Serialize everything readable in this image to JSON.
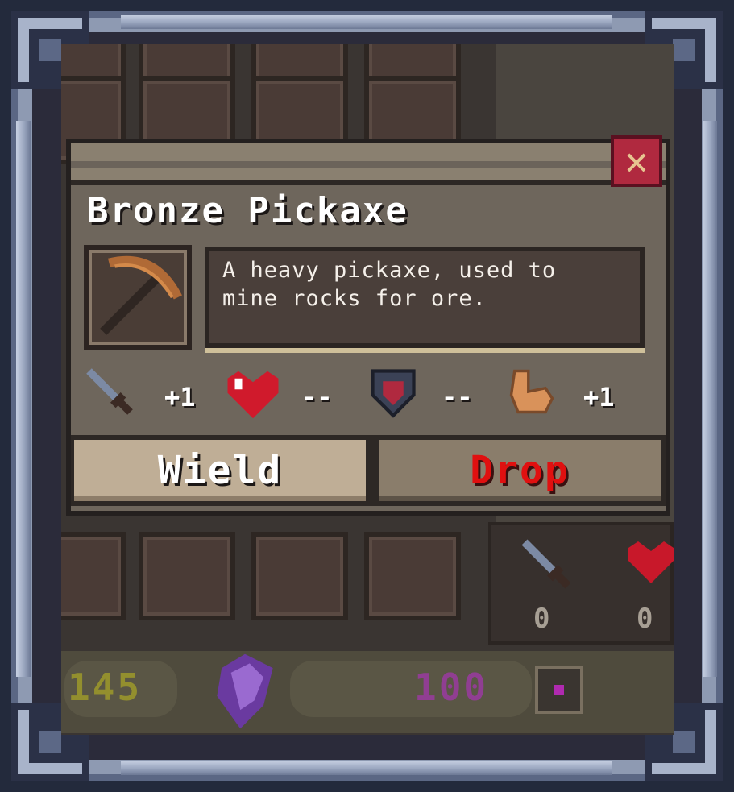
{
  "item": {
    "name": "Bronze Pickaxe",
    "description_line1": "A heavy pickaxe, used to",
    "description_line2": "mine rocks for ore.",
    "icon": "bronze-pickaxe-icon"
  },
  "stats": [
    {
      "icon": "sword-icon",
      "label": "attack",
      "value": "+1"
    },
    {
      "icon": "heart-icon",
      "label": "health",
      "value": "--"
    },
    {
      "icon": "shield-icon",
      "label": "defense",
      "value": "--"
    },
    {
      "icon": "flexed-arm-icon",
      "label": "strength",
      "value": "+1"
    }
  ],
  "actions": {
    "wield_label": "Wield",
    "drop_label": "Drop"
  },
  "background": {
    "gold_count": "145",
    "gem_count": "100",
    "stat_attack": "0",
    "stat_health": "0"
  },
  "colors": {
    "drop": "#e01010",
    "wield_bg": "#bfae96",
    "panel": "#6e665c"
  }
}
